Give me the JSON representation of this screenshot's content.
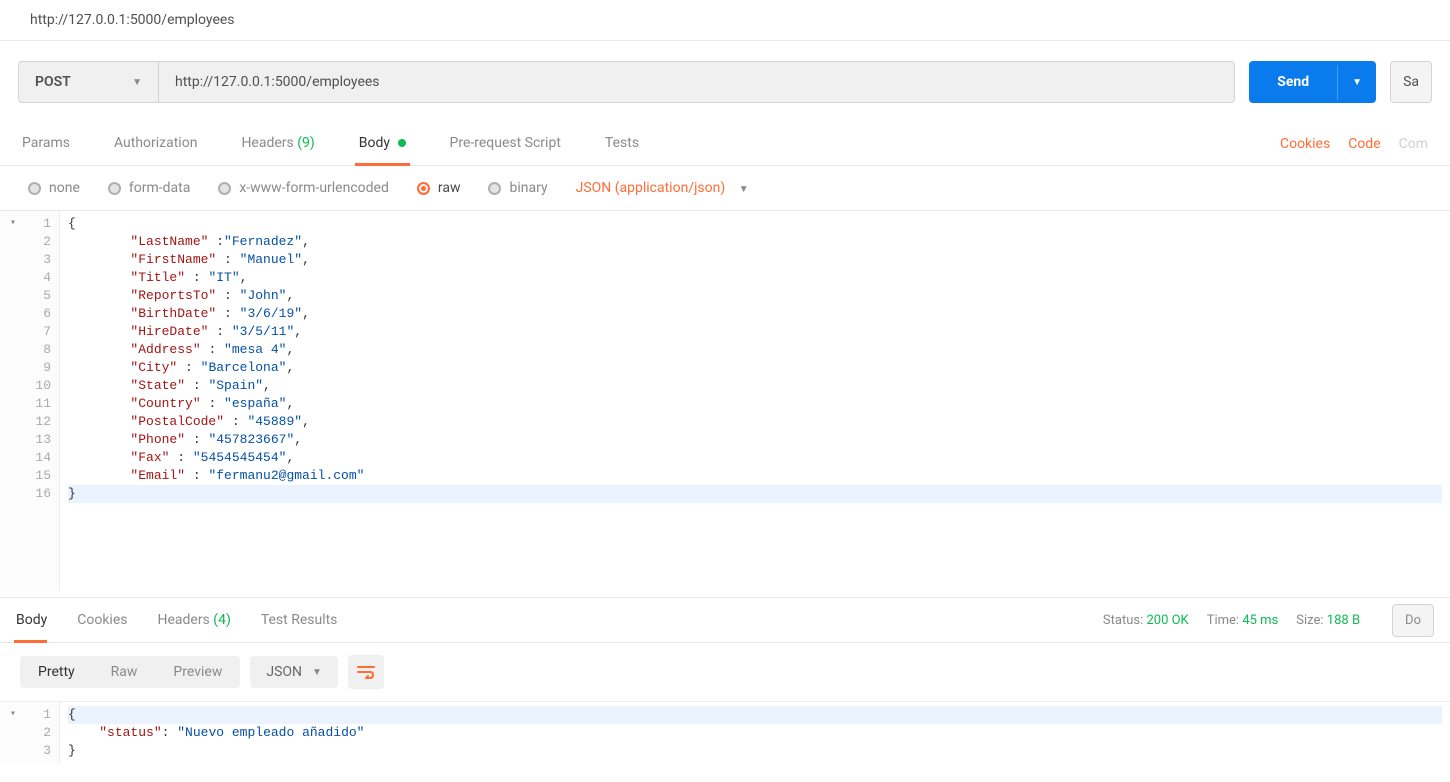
{
  "topUrl": "http://127.0.0.1:5000/employees",
  "request": {
    "method": "POST",
    "url": "http://127.0.0.1:5000/employees",
    "sendLabel": "Send",
    "saveLabel": "Sa"
  },
  "tabs": {
    "params": "Params",
    "authorization": "Authorization",
    "headersLabel": "Headers",
    "headersCount": "(9)",
    "body": "Body",
    "prerequest": "Pre-request Script",
    "tests": "Tests"
  },
  "rightLinks": {
    "cookies": "Cookies",
    "code": "Code",
    "comments": "Com"
  },
  "bodyTypes": {
    "none": "none",
    "formData": "form-data",
    "urlencoded": "x-www-form-urlencoded",
    "raw": "raw",
    "binary": "binary",
    "contentType": "JSON (application/json)"
  },
  "requestBody": {
    "lines": [
      {
        "n": "1",
        "fold": true,
        "segs": [
          {
            "t": "{",
            "c": "tok-p"
          }
        ]
      },
      {
        "n": "2",
        "segs": [
          {
            "t": "        ",
            "c": ""
          },
          {
            "t": "\"LastName\"",
            "c": "tok-k"
          },
          {
            "t": " :",
            "c": "tok-p"
          },
          {
            "t": "\"Fernadez\"",
            "c": "tok-s"
          },
          {
            "t": ",",
            "c": "tok-p"
          }
        ]
      },
      {
        "n": "3",
        "segs": [
          {
            "t": "        ",
            "c": ""
          },
          {
            "t": "\"FirstName\"",
            "c": "tok-k"
          },
          {
            "t": " : ",
            "c": "tok-p"
          },
          {
            "t": "\"Manuel\"",
            "c": "tok-s"
          },
          {
            "t": ",",
            "c": "tok-p"
          }
        ]
      },
      {
        "n": "4",
        "segs": [
          {
            "t": "        ",
            "c": ""
          },
          {
            "t": "\"Title\"",
            "c": "tok-k"
          },
          {
            "t": " : ",
            "c": "tok-p"
          },
          {
            "t": "\"IT\"",
            "c": "tok-s"
          },
          {
            "t": ",",
            "c": "tok-p"
          }
        ]
      },
      {
        "n": "5",
        "segs": [
          {
            "t": "        ",
            "c": ""
          },
          {
            "t": "\"ReportsTo\"",
            "c": "tok-k"
          },
          {
            "t": " : ",
            "c": "tok-p"
          },
          {
            "t": "\"John\"",
            "c": "tok-s"
          },
          {
            "t": ",",
            "c": "tok-p"
          }
        ]
      },
      {
        "n": "6",
        "segs": [
          {
            "t": "        ",
            "c": ""
          },
          {
            "t": "\"BirthDate\"",
            "c": "tok-k"
          },
          {
            "t": " : ",
            "c": "tok-p"
          },
          {
            "t": "\"3/6/19\"",
            "c": "tok-s"
          },
          {
            "t": ",",
            "c": "tok-p"
          }
        ]
      },
      {
        "n": "7",
        "segs": [
          {
            "t": "        ",
            "c": ""
          },
          {
            "t": "\"HireDate\"",
            "c": "tok-k"
          },
          {
            "t": " : ",
            "c": "tok-p"
          },
          {
            "t": "\"3/5/11\"",
            "c": "tok-s"
          },
          {
            "t": ",",
            "c": "tok-p"
          }
        ]
      },
      {
        "n": "8",
        "segs": [
          {
            "t": "        ",
            "c": ""
          },
          {
            "t": "\"Address\"",
            "c": "tok-k"
          },
          {
            "t": " : ",
            "c": "tok-p"
          },
          {
            "t": "\"mesa 4\"",
            "c": "tok-s"
          },
          {
            "t": ",",
            "c": "tok-p"
          }
        ]
      },
      {
        "n": "9",
        "segs": [
          {
            "t": "        ",
            "c": ""
          },
          {
            "t": "\"City\"",
            "c": "tok-k"
          },
          {
            "t": " : ",
            "c": "tok-p"
          },
          {
            "t": "\"Barcelona\"",
            "c": "tok-s"
          },
          {
            "t": ",",
            "c": "tok-p"
          }
        ]
      },
      {
        "n": "10",
        "segs": [
          {
            "t": "        ",
            "c": ""
          },
          {
            "t": "\"State\"",
            "c": "tok-k"
          },
          {
            "t": " : ",
            "c": "tok-p"
          },
          {
            "t": "\"Spain\"",
            "c": "tok-s"
          },
          {
            "t": ",",
            "c": "tok-p"
          }
        ]
      },
      {
        "n": "11",
        "segs": [
          {
            "t": "        ",
            "c": ""
          },
          {
            "t": "\"Country\"",
            "c": "tok-k"
          },
          {
            "t": " : ",
            "c": "tok-p"
          },
          {
            "t": "\"españa\"",
            "c": "tok-s"
          },
          {
            "t": ",",
            "c": "tok-p"
          }
        ]
      },
      {
        "n": "12",
        "segs": [
          {
            "t": "        ",
            "c": ""
          },
          {
            "t": "\"PostalCode\"",
            "c": "tok-k"
          },
          {
            "t": " : ",
            "c": "tok-p"
          },
          {
            "t": "\"45889\"",
            "c": "tok-s"
          },
          {
            "t": ",",
            "c": "tok-p"
          }
        ]
      },
      {
        "n": "13",
        "segs": [
          {
            "t": "        ",
            "c": ""
          },
          {
            "t": "\"Phone\"",
            "c": "tok-k"
          },
          {
            "t": " : ",
            "c": "tok-p"
          },
          {
            "t": "\"457823667\"",
            "c": "tok-s"
          },
          {
            "t": ",",
            "c": "tok-p"
          }
        ]
      },
      {
        "n": "14",
        "segs": [
          {
            "t": "        ",
            "c": ""
          },
          {
            "t": "\"Fax\"",
            "c": "tok-k"
          },
          {
            "t": " : ",
            "c": "tok-p"
          },
          {
            "t": "\"5454545454\"",
            "c": "tok-s"
          },
          {
            "t": ",",
            "c": "tok-p"
          }
        ]
      },
      {
        "n": "15",
        "segs": [
          {
            "t": "        ",
            "c": ""
          },
          {
            "t": "\"Email\"",
            "c": "tok-k"
          },
          {
            "t": " : ",
            "c": "tok-p"
          },
          {
            "t": "\"fermanu2@gmail.com\"",
            "c": "tok-s"
          }
        ]
      },
      {
        "n": "16",
        "hl": true,
        "segs": [
          {
            "t": "}",
            "c": "tok-p"
          }
        ]
      }
    ]
  },
  "responseTabs": {
    "body": "Body",
    "cookies": "Cookies",
    "headersLabel": "Headers",
    "headersCount": "(4)",
    "testResults": "Test Results"
  },
  "status": {
    "statusLabel": "Status:",
    "statusValue": "200 OK",
    "timeLabel": "Time:",
    "timeValue": "45 ms",
    "sizeLabel": "Size:",
    "sizeValue": "188 B",
    "downloadLabel": "Do"
  },
  "viewOptions": {
    "pretty": "Pretty",
    "raw": "Raw",
    "preview": "Preview",
    "format": "JSON"
  },
  "responseBody": {
    "lines": [
      {
        "n": "1",
        "fold": true,
        "hl": true,
        "segs": [
          {
            "t": "{",
            "c": "tok-p"
          }
        ]
      },
      {
        "n": "2",
        "segs": [
          {
            "t": "    ",
            "c": ""
          },
          {
            "t": "\"status\"",
            "c": "tok-k"
          },
          {
            "t": ": ",
            "c": "tok-p"
          },
          {
            "t": "\"Nuevo empleado añadido\"",
            "c": "tok-s"
          }
        ]
      },
      {
        "n": "3",
        "segs": [
          {
            "t": "}",
            "c": "tok-p"
          }
        ]
      }
    ]
  }
}
